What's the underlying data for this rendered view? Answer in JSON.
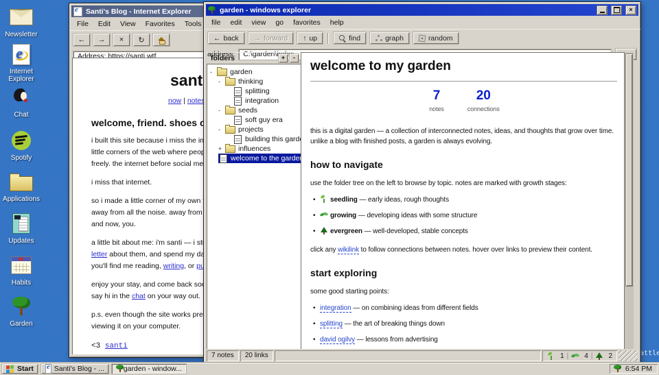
{
  "desktop": {
    "wallpaper_text": "seattle",
    "icons": [
      {
        "icon": "envelope-icon",
        "label": "Newsletter"
      },
      {
        "icon": "ie-logo-icon",
        "label": "Internet Explorer"
      },
      {
        "icon": "chat-person-icon",
        "label": "Chat"
      },
      {
        "icon": "spotify-icon",
        "label": "Spotify"
      },
      {
        "icon": "folder-icon",
        "label": "Applications"
      },
      {
        "icon": "notepad-icon",
        "label": "Updates"
      },
      {
        "icon": "calendar-icon",
        "label": "Habits"
      },
      {
        "icon": "tree-icon",
        "label": "Garden"
      }
    ]
  },
  "taskbar": {
    "start_label": "Start",
    "tasks": [
      {
        "icon": "ie-logo-icon",
        "label": "Santi's Blog - ...",
        "active": false
      },
      {
        "icon": "tree-icon",
        "label": "garden - window...",
        "active": true
      }
    ],
    "tray": {
      "icon": "tree-icon",
      "time": "6:54 PM"
    }
  },
  "ie_window": {
    "title": "Santi's Blog - Internet Explorer",
    "menu": [
      "File",
      "Edit",
      "View",
      "Favorites",
      "Tools",
      "Help"
    ],
    "toolbar": {
      "back": "←",
      "forward": "→",
      "stop": "×",
      "refresh": "↻",
      "home_icon": "home-icon"
    },
    "address": "Address: https://santi.wtf",
    "content": {
      "heading": "santi",
      "nav_link1": "now",
      "nav_sep": " | ",
      "nav_link2": "notes",
      "welcome_heading": "welcome, friend. shoes off",
      "p1_l1": "i built this site because i miss the inter",
      "p1_l2": "little corners of the web where people",
      "p1_l3": "freely. the internet before social media",
      "p2_l1": "i miss that internet.",
      "p3_l1": "so i made a little corner of my own to",
      "p3_l2": "away from all the noise. away from alg",
      "p3_l3": "and now, you.",
      "p4_l1": "a little bit about me: i'm santi — i stud",
      "p4_l2_link": "letter",
      "p4_l2_rest": " about them, and spend my days",
      "p4_l3_pre": "you'll find me reading, ",
      "p4_l3_link1": "writing",
      "p4_l3_mid": ", or ",
      "p4_l3_link2": "push",
      "p5_l1": "enjoy your stay, and come back soon -",
      "p5_l2_pre": "say hi in the ",
      "p5_l2_link": "chat",
      "p5_l2_rest": " on your way out.",
      "p6_l1": "p.s. even though the site works pretty",
      "p6_l2": "viewing it on your computer.",
      "sig_pre": "<3 ",
      "sig_link": "santi"
    }
  },
  "garden_window": {
    "title": "garden - windows explorer",
    "menu": [
      "file",
      "edit",
      "view",
      "go",
      "favorites",
      "help"
    ],
    "toolbar": [
      {
        "glyph": "←",
        "label": "back",
        "disabled": false
      },
      {
        "glyph": "→",
        "label": "forward",
        "disabled": true
      },
      {
        "glyph": "↑",
        "label": "up",
        "disabled": false
      },
      {
        "icon": "magnifier-icon",
        "label": "find"
      },
      {
        "icon": "graph-icon",
        "label": "graph"
      },
      {
        "icon": "dice-icon",
        "label": "random"
      }
    ],
    "address_label": "address:",
    "address_value": "C:\\garden\\index",
    "go_label": "go",
    "folders_panel": {
      "header": "folders",
      "expand_all": "+",
      "collapse_all": "-",
      "tree": [
        {
          "label": "garden",
          "type": "folder",
          "expander": "-"
        },
        {
          "label": "thinking",
          "type": "folder",
          "expander": "-"
        },
        {
          "label": "splitting",
          "type": "doc"
        },
        {
          "label": "integration",
          "type": "doc"
        },
        {
          "label": "seeds",
          "type": "folder",
          "expander": "-"
        },
        {
          "label": "soft guy era",
          "type": "doc"
        },
        {
          "label": "projects",
          "type": "folder",
          "expander": "-"
        },
        {
          "label": "building this garden",
          "type": "doc"
        },
        {
          "label": "influences",
          "type": "folder",
          "expander": "+"
        },
        {
          "label": "welcome to the garden",
          "type": "doc",
          "selected": true
        }
      ]
    },
    "content": {
      "title": "welcome to my garden",
      "stats": [
        {
          "value": "7",
          "label": "notes"
        },
        {
          "value": "20",
          "label": "connections"
        }
      ],
      "intro": "this is a digital garden — a collection of interconnected notes, ideas, and thoughts that grow over time. unlike a blog with finished posts, a garden is always evolving.",
      "how_heading": "how to navigate",
      "how_intro": "use the folder tree on the left to browse by topic. notes are marked with growth stages:",
      "stages": [
        {
          "icon": "seedling-icon",
          "term": "seedling",
          "desc": " — early ideas, rough thoughts"
        },
        {
          "icon": "growing-icon",
          "term": "growing",
          "desc": " — developing ideas with some structure"
        },
        {
          "icon": "evergreen-icon",
          "term": "evergreen",
          "desc": " — well-developed, stable concepts"
        }
      ],
      "wikilink_pre": "click any ",
      "wikilink_link": "wikilink",
      "wikilink_rest": " to follow connections between notes. hover over links to preview their content.",
      "explore_heading": "start exploring",
      "explore_intro": "some good starting points:",
      "explore_links": [
        {
          "link": "integration",
          "desc": " — on combining ideas from different fields"
        },
        {
          "link": "splitting",
          "desc": " — the art of breaking things down"
        },
        {
          "link": "david ogilvy",
          "desc": " — lessons from advertising"
        }
      ]
    },
    "status_bar": {
      "notes": "7 notes",
      "links": "20 links",
      "stage_counts": [
        {
          "icon": "seedling-icon",
          "count": "1"
        },
        {
          "icon": "growing-icon",
          "count": "4"
        },
        {
          "icon": "evergreen-icon",
          "count": "2"
        }
      ],
      "sep": "|"
    },
    "accent_colors": {
      "titlebar": "#1430bf",
      "selection": "#0a1a9e",
      "link": "#2644cc",
      "stat_number": "#0c1ecb"
    }
  }
}
